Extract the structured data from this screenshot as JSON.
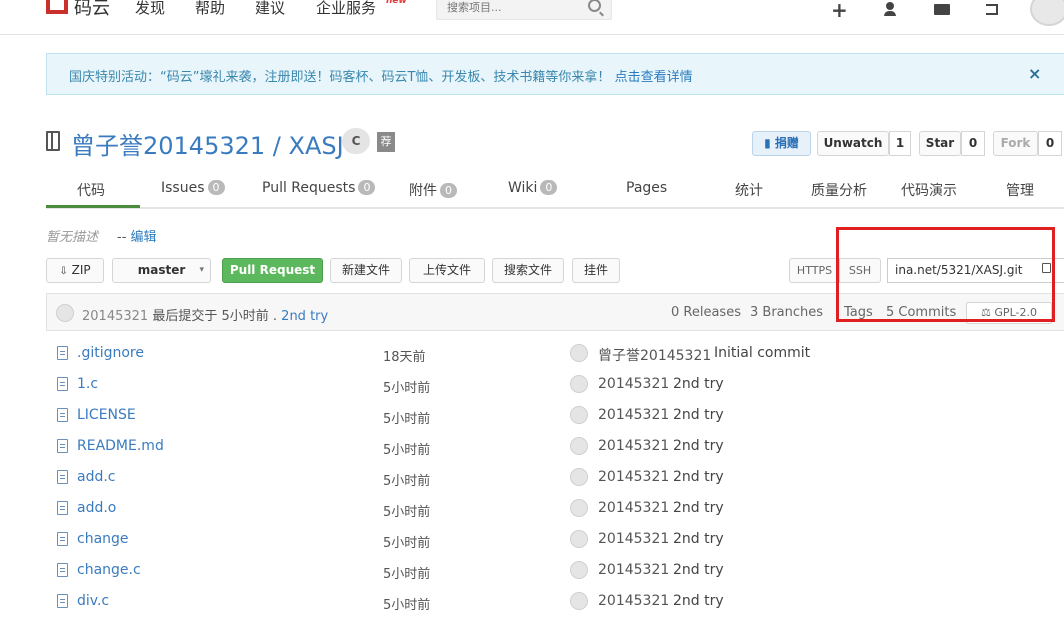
{
  "topnav": {
    "logo_text": "码云",
    "links": [
      "发现",
      "帮助",
      "建议",
      "企业服务"
    ],
    "new_badge": "new",
    "search_placeholder": "搜索项目...",
    "icons": [
      "plus-icon",
      "user-icon",
      "mail-icon",
      "logout-icon"
    ]
  },
  "banner": {
    "text": "国庆特别活动：“码云”壕礼来袭，注册即送！码客杯、码云T恤、开发板、技术书籍等你来拿！",
    "link": "点击查看详情",
    "close": "×"
  },
  "repo": {
    "title": "曾子誉20145321 / XASJ",
    "lang_badge": "C",
    "rec_badge": "荐",
    "donate": "捐赠",
    "unwatch": "Unwatch",
    "unwatch_count": "1",
    "star": "Star",
    "star_count": "0",
    "fork": "Fork",
    "fork_count": "0"
  },
  "tabs": [
    {
      "label": "代码",
      "count": ""
    },
    {
      "label": "Issues",
      "count": "0"
    },
    {
      "label": "Pull Requests",
      "count": "0"
    },
    {
      "label": "附件",
      "count": "0"
    },
    {
      "label": "Wiki",
      "count": "0"
    },
    {
      "label": "Pages",
      "count": ""
    },
    {
      "label": "统计",
      "count": ""
    },
    {
      "label": "质量分析",
      "count": ""
    },
    {
      "label": "代码演示",
      "count": ""
    },
    {
      "label": "管理",
      "count": ""
    }
  ],
  "description": {
    "empty": "暂无描述",
    "sep": "--",
    "edit": "编辑"
  },
  "toolbar": {
    "zip": "ZIP",
    "branch": "master",
    "pull_request": "Pull Request",
    "new_file": "新建文件",
    "upload_file": "上传文件",
    "search_file": "搜索文件",
    "hook": "挂件",
    "https": "HTTPS",
    "ssh": "SSH",
    "clone_url": "ina.net/5321/XASJ.git"
  },
  "commit": {
    "author": "20145321",
    "label": "最后提交于",
    "time": "5小时前",
    "dot": ".",
    "message": "2nd try",
    "releases": "0 Releases",
    "branches": "3 Branches",
    "tags": "Tags",
    "commits": "5 Commits",
    "license": "GPL-2.0"
  },
  "files": [
    {
      "name": ".gitignore",
      "time": "18天前",
      "author": "曾子誉20145321",
      "message": "Initial commit"
    },
    {
      "name": "1.c",
      "time": "5小时前",
      "author": "20145321",
      "message": "2nd try"
    },
    {
      "name": "LICENSE",
      "time": "5小时前",
      "author": "20145321",
      "message": "2nd try"
    },
    {
      "name": "README.md",
      "time": "5小时前",
      "author": "20145321",
      "message": "2nd try"
    },
    {
      "name": "add.c",
      "time": "5小时前",
      "author": "20145321",
      "message": "2nd try"
    },
    {
      "name": "add.o",
      "time": "5小时前",
      "author": "20145321",
      "message": "2nd try"
    },
    {
      "name": "change",
      "time": "5小时前",
      "author": "20145321",
      "message": "2nd try"
    },
    {
      "name": "change.c",
      "time": "5小时前",
      "author": "20145321",
      "message": "2nd try"
    },
    {
      "name": "div.c",
      "time": "5小时前",
      "author": "20145321",
      "message": "2nd try"
    }
  ],
  "colors": {
    "accent": "#3a7bbf",
    "green": "#5cb85c",
    "highlight": "#e02020"
  }
}
